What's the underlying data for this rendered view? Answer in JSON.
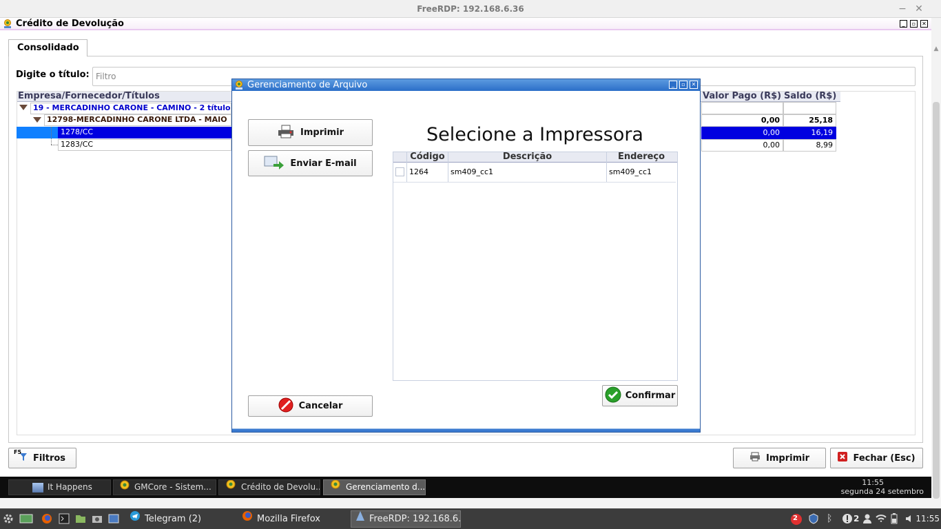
{
  "rdp_window": {
    "title": "FreeRDP: 192.168.6.36",
    "minimize": "−",
    "close": "✕"
  },
  "app": {
    "title": "Crédito de Devolução",
    "tab": "Consolidado",
    "filter_label": "Digite o título:",
    "filter_placeholder": "Filtro",
    "columns": {
      "empresa": "Empresa/Fornecedor/Títulos",
      "valor_pago": "Valor Pago (R$)",
      "saldo": "Saldo (R$)"
    },
    "tree": {
      "group": "19 - MERCADINHO CARONE - CAMINO - 2 título",
      "subgroup": "12798-MERCADINHO CARONE LTDA - MAIO",
      "subgroup_valor_pago": "0,00",
      "subgroup_saldo": "25,18",
      "rows": [
        {
          "titulo": "1278/CC",
          "valor_pago": "0,00",
          "saldo": "16,19",
          "selected": true
        },
        {
          "titulo": "1283/CC",
          "valor_pago": "0,00",
          "saldo": "8,99",
          "selected": false
        }
      ]
    },
    "bottom": {
      "f5": "F5",
      "filtros": "Filtros",
      "imprimir": "Imprimir",
      "fechar": "Fechar (Esc)"
    }
  },
  "dialog": {
    "title": "Gerenciamento de Arquivo",
    "imprimir": "Imprimir",
    "enviar_email": "Enviar E-mail",
    "cancelar": "Cancelar",
    "heading": "Selecione a Impressora",
    "columns": {
      "codigo": "Código",
      "descricao": "Descrição",
      "endereco": "Endereço"
    },
    "printers": [
      {
        "codigo": "1264",
        "descricao": "sm409_cc1",
        "endereco": "sm409_cc1"
      }
    ],
    "confirmar": "Confirmar"
  },
  "inner_taskbar": {
    "items": [
      "It Happens",
      "GMCore - Sistem...",
      "Crédito de Devolu...",
      "Gerenciamento d..."
    ],
    "time": "11:55",
    "date": "segunda 24 setembro"
  },
  "system_panel": {
    "tasks": [
      "Telegram (2)",
      "Mozilla Firefox",
      "FreeRDP: 192.168.6...."
    ],
    "notif_badge": "2",
    "alert_count": "2",
    "time": "11:55"
  },
  "colors": {
    "selection": "#0000e0",
    "group_text": "#0000cc",
    "dialog_title": "#2b6ec8"
  }
}
